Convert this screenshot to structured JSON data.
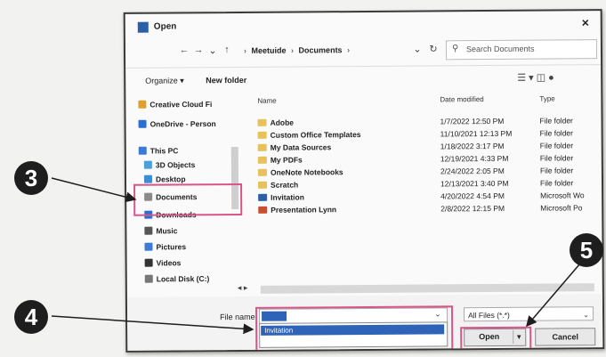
{
  "window": {
    "title": "Open",
    "close_glyph": "×"
  },
  "nav": {
    "back": "←",
    "forward": "→",
    "up": "↑",
    "recent": "⌄",
    "breadcrumbs": [
      "Meetuide",
      "Documents"
    ],
    "separator": "›",
    "refresh": "↻",
    "search_placeholder": "Search Documents",
    "search_icon": "search-icon"
  },
  "toolbar": {
    "organize": "Organize ▾",
    "new_folder": "New folder",
    "view_icons": "☰ ▾  ◫  ●"
  },
  "sidebar": {
    "items": [
      {
        "label": "Creative Cloud Fi",
        "icon": "cloud-icon",
        "color": "#e0a030"
      },
      {
        "label": "OneDrive - Person",
        "icon": "onedrive-icon",
        "color": "#2b6fd1"
      },
      {
        "label": "This PC",
        "icon": "pc-icon",
        "color": "#3a7bd5"
      },
      {
        "label": "3D Objects",
        "icon": "cube-icon",
        "color": "#4aa0d8"
      },
      {
        "label": "Desktop",
        "icon": "desktop-icon",
        "color": "#3b8ed6"
      },
      {
        "label": "Documents",
        "icon": "document-icon",
        "color": "#8a8a8a"
      },
      {
        "label": "Downloads",
        "icon": "download-icon",
        "color": "#2b6fd1"
      },
      {
        "label": "Music",
        "icon": "music-icon",
        "color": "#555555"
      },
      {
        "label": "Pictures",
        "icon": "pictures-icon",
        "color": "#3a7bd5"
      },
      {
        "label": "Videos",
        "icon": "video-icon",
        "color": "#333333"
      },
      {
        "label": "Local Disk (C:)",
        "icon": "disk-icon",
        "color": "#777777"
      }
    ]
  },
  "file_list": {
    "headers": {
      "name": "Name",
      "date": "Date modified",
      "type": "Type"
    },
    "rows": [
      {
        "name": "Adobe",
        "date": "1/7/2022 12:50 PM",
        "type": "File folder"
      },
      {
        "name": "Custom Office Templates",
        "date": "11/10/2021 12:13 PM",
        "type": "File folder"
      },
      {
        "name": "My Data Sources",
        "date": "1/18/2022 3:17 PM",
        "type": "File folder"
      },
      {
        "name": "My PDFs",
        "date": "12/19/2021 4:33 PM",
        "type": "File folder"
      },
      {
        "name": "OneNote Notebooks",
        "date": "2/24/2022 2:05 PM",
        "type": "File folder"
      },
      {
        "name": "Scratch",
        "date": "12/13/2021 3:40 PM",
        "type": "File folder"
      },
      {
        "name": "Invitation",
        "date": "4/20/2022 4:54 PM",
        "type": "Microsoft Wo"
      },
      {
        "name": "Presentation Lynn",
        "date": "2/8/2022 12:15 PM",
        "type": "Microsoft Po"
      }
    ]
  },
  "footer": {
    "file_name_label": "File name:",
    "file_name_value": "",
    "autocomplete_item": "Invitation",
    "file_type": "All Files (*.*)",
    "open_label": "Open",
    "open_split": "▾",
    "cancel_label": "Cancel",
    "dropdown_glyph": "⌄"
  },
  "callouts": {
    "three": "3",
    "four": "4",
    "five": "5"
  },
  "colors": {
    "highlight": "#d8558a",
    "selection": "#2f63b8",
    "folder": "#e7c15a"
  }
}
